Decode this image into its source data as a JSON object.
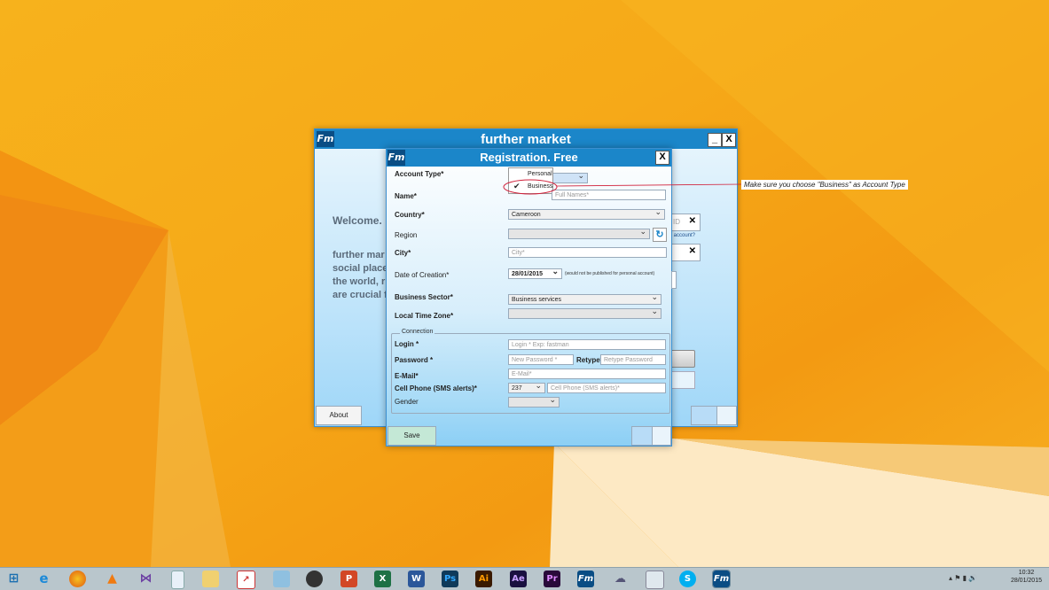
{
  "back_window": {
    "title": "further market",
    "minimize": "_",
    "close": "X",
    "welcome": "Welcome.",
    "body_lines": [
      "further mar",
      "social place",
      "the world, r",
      "are crucial f"
    ],
    "id_partial": "ID",
    "account_partial": "r account?",
    "about_button": "About"
  },
  "registration": {
    "title": "Registration. Free",
    "close": "X",
    "account_type": {
      "label": "Account Type*",
      "options": [
        "Personal",
        "Business"
      ],
      "selected": "Business"
    },
    "name": {
      "label": "Name*",
      "placeholder": "Full Names*"
    },
    "country": {
      "label": "Country*",
      "value": "Cameroon"
    },
    "region": {
      "label": "Region",
      "value": ""
    },
    "city": {
      "label": "City*",
      "placeholder": "City*"
    },
    "date_of_creation": {
      "label": "Date of Creation*",
      "value": "28/01/2015",
      "note": "(would not be published for personal account)"
    },
    "business_sector": {
      "label": "Business Sector*",
      "value": "Business services"
    },
    "time_zone": {
      "label": "Local Time Zone*",
      "value": ""
    },
    "connection": {
      "legend": "Connection",
      "login": {
        "label": "Login *",
        "placeholder": "Login *  Exp: fastman"
      },
      "password": {
        "label": "Password *",
        "placeholder": "New Password *"
      },
      "retype": {
        "label": "Retype*",
        "placeholder": "Retype Password"
      },
      "email": {
        "label": "E-Mail*",
        "placeholder": "E-Mail*"
      },
      "cell": {
        "label": "Cell Phone (SMS alerts)*",
        "code": "237",
        "placeholder": "Cell Phone (SMS alerts)*"
      },
      "gender": {
        "label": "Gender",
        "value": ""
      }
    },
    "save_button": "Save"
  },
  "annotation": "Make sure you choose \"Business\" as Account Type",
  "taskbar": {
    "icons": [
      "windows-logo-icon",
      "internet-explorer-icon",
      "firefox-icon",
      "vlc-icon",
      "visual-studio-icon",
      "notepad-icon",
      "file-explorer-icon",
      "task-manager-icon",
      "app-icon",
      "camera-icon",
      "powerpoint-icon",
      "excel-icon",
      "word-icon",
      "photoshop-icon",
      "illustrator-icon",
      "after-effects-icon",
      "premiere-icon",
      "further-market-icon",
      "network-icon",
      "remote-icon",
      "skype-icon",
      "further-market-active-icon"
    ],
    "labels": {
      "word": "W",
      "ppt": "P",
      "excel": "X",
      "ps": "Ps",
      "ai": "Ai",
      "ae": "Ae",
      "pr": "Pr",
      "fm": "Fm",
      "skype": "S"
    },
    "clock_time": "10:32",
    "clock_date": "28/01/2015"
  },
  "colors": {
    "title_blue": "#1b86c9",
    "logo_navy": "#0a4d84",
    "desktop_orange": "#f6a918"
  }
}
